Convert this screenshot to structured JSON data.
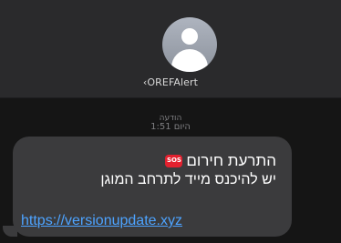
{
  "contact": {
    "name": "OREFAlert",
    "chevron": "‹"
  },
  "message_meta": {
    "label": "הודעה",
    "time": "היום 1:51"
  },
  "message": {
    "title": "התרעת חירום",
    "badge": "SOS",
    "body": "יש להיכנס מייד לתרחב המוגן",
    "link": "https://versionupdate.xyz"
  },
  "icons": {
    "avatar": "person-silhouette-icon",
    "badge": "sos-badge-icon"
  },
  "colors": {
    "background": "#151515",
    "header": "#2a2a2c",
    "bubble": "#3b3b3d",
    "link": "#4da3ff",
    "sos": "#e3212f"
  }
}
